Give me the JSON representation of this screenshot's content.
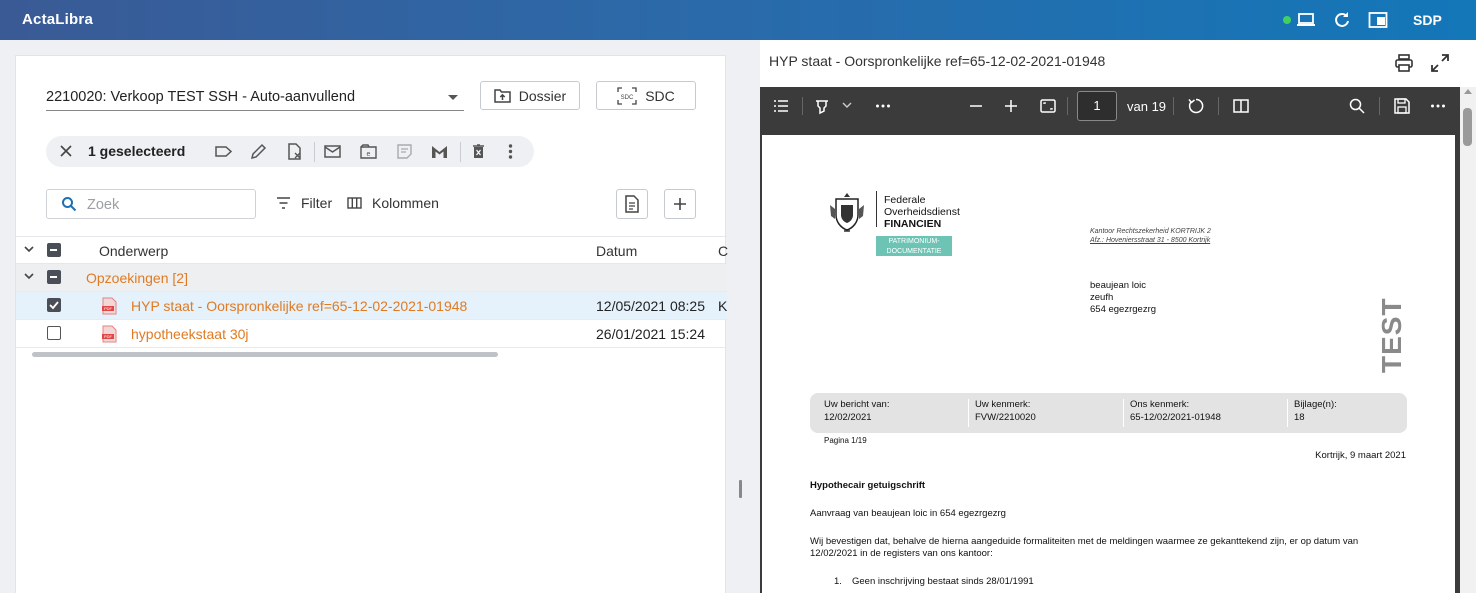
{
  "app": {
    "title": "ActaLibra",
    "user": "SDP"
  },
  "topbar_icons": [
    "laptop-icon",
    "refresh-icon",
    "window-icon"
  ],
  "left": {
    "dossier": "2210020: Verkoop TEST SSH - Auto-aanvullend",
    "buttons": {
      "dossier": "Dossier",
      "sdc": "SDC",
      "sdc_icon_text": "SDC"
    },
    "selection": {
      "count_label": "1 geselecteerd"
    },
    "search": {
      "placeholder": "Zoek",
      "value": ""
    },
    "filter_label": "Filter",
    "columns_label": "Kolommen",
    "grid": {
      "headers": {
        "subject": "Onderwerp",
        "date": "Datum",
        "extra": "C"
      },
      "group": {
        "label": "Opzoekingen [2]"
      },
      "rows": [
        {
          "subject": "HYP staat - Oorspronkelijke ref=65-12-02-2021-01948",
          "date": "12/05/2021 08:25",
          "extra": "K",
          "selected": true,
          "file_icon": "pdf-icon",
          "file_icon_text": "PDF"
        },
        {
          "subject": "hypotheekstaat 30j",
          "date": "26/01/2021 15:24",
          "extra": "",
          "selected": false,
          "file_icon": "pdf-icon",
          "file_icon_text": "PDF"
        }
      ]
    }
  },
  "right": {
    "doc_title": "HYP staat - Oorspronkelijke ref=65-12-02-2021-01948",
    "viewer": {
      "current_page": "1",
      "page_count_label": "van 19"
    },
    "pdf": {
      "org_lines": [
        "Federale",
        "Overheidsdienst",
        "FINANCIEN"
      ],
      "badge_lines": [
        "PATRIMONIUM-",
        "DOCUMENTATIE"
      ],
      "office_lines": [
        "Kantoor Rechtszekerheid KORTRIJK 2",
        "Afz.: Hoveniersstraat 31 - 8500 Kortrijk"
      ],
      "recipient_lines": [
        "beaujean loic",
        "zeufh",
        "654 egezrgezrg"
      ],
      "watermark": "TEST",
      "info": [
        {
          "label": "Uw bericht van:",
          "value": "12/02/2021"
        },
        {
          "label": "Uw kenmerk:",
          "value": "FVW/2210020"
        },
        {
          "label": "Ons kenmerk:",
          "value": "65-12/02/2021-01948"
        },
        {
          "label": "Bijlage(n):",
          "value": "18"
        }
      ],
      "pagina": "Pagina 1/19",
      "place_date": "Kortrijk, 9 maart 2021",
      "heading": "Hypothecair getuigschrift",
      "request": "Aanvraag van  beaujean loic in 654 egezrgezrg",
      "body_line1": "Wij bevestigen dat, behalve de hierna aangeduide formaliteiten met de meldingen waarmee ze gekanttekend zijn, er op datum van",
      "body_line2": "12/02/2021 in de registers van ons kantoor:",
      "list_item1_num": "1.",
      "list_item1": "Geen inschrijving bestaat sinds 28/01/1991"
    }
  },
  "colors": {
    "accent_orange": "#e07b22",
    "topbar": "#2c69a9",
    "status_green": "#3fd25e",
    "viewer_bg": "#3b3b3b"
  }
}
